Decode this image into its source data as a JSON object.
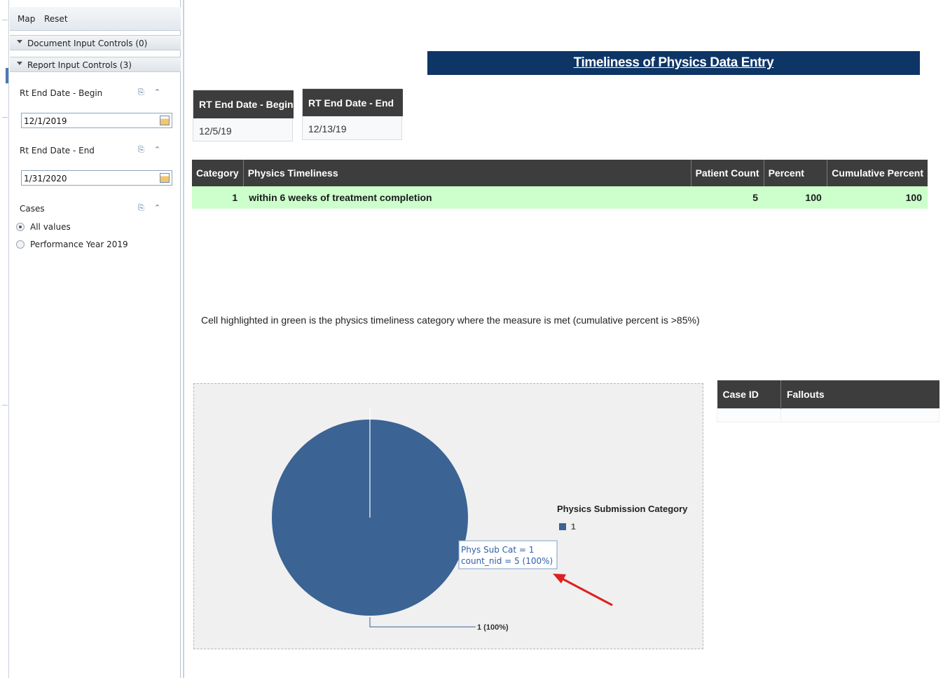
{
  "panel": {
    "menu": {
      "map": "Map",
      "reset": "Reset"
    },
    "document_section": "Document Input Controls (0)",
    "report_section": "Report Input Controls (3)",
    "controls": [
      {
        "label": "Rt End Date - Begin",
        "value": "12/1/2019"
      },
      {
        "label": "Rt End Date - End",
        "value": "1/31/2020"
      }
    ],
    "cases": {
      "label": "Cases",
      "options": [
        {
          "label": "All values",
          "selected": true
        },
        {
          "label": "Performance Year 2019",
          "selected": false
        }
      ]
    },
    "icons": [
      "filter-icon",
      "collapse-icon",
      "calendar-icon"
    ]
  },
  "report": {
    "title": "Timeliness of Physics Data Entry",
    "params": [
      {
        "header": "RT End Date - Begin",
        "value": "12/5/19"
      },
      {
        "header": "RT End Date - End",
        "value": "12/13/19"
      }
    ],
    "table": {
      "headers": [
        "Category",
        "Physics Timeliness",
        "Patient Count",
        "Percent",
        "Cumulative Percent"
      ],
      "rows": [
        [
          "1",
          "within 6 weeks of treatment completion",
          "5",
          "100",
          "100"
        ]
      ],
      "highlight_color": "#ccffcc"
    },
    "footnote": "Cell highlighted in green is the physics timeliness category where the measure is met (cumulative percent is >85%)",
    "fallouts": {
      "headers": [
        "Case ID",
        "Fallouts"
      ],
      "rows": []
    }
  },
  "chart_data": {
    "type": "pie",
    "categories": [
      "1"
    ],
    "values": [
      5
    ],
    "legend_title": "Physics Submission Category",
    "legend": [
      "1"
    ],
    "slice_label": "1 (100%)",
    "tooltip": {
      "line1": "Phys Sub Cat = 1",
      "line2_key": "count_nid = 5",
      "line2_pct": " (100%)"
    },
    "colors": [
      "#3b6394"
    ],
    "legend_placement": "right"
  }
}
